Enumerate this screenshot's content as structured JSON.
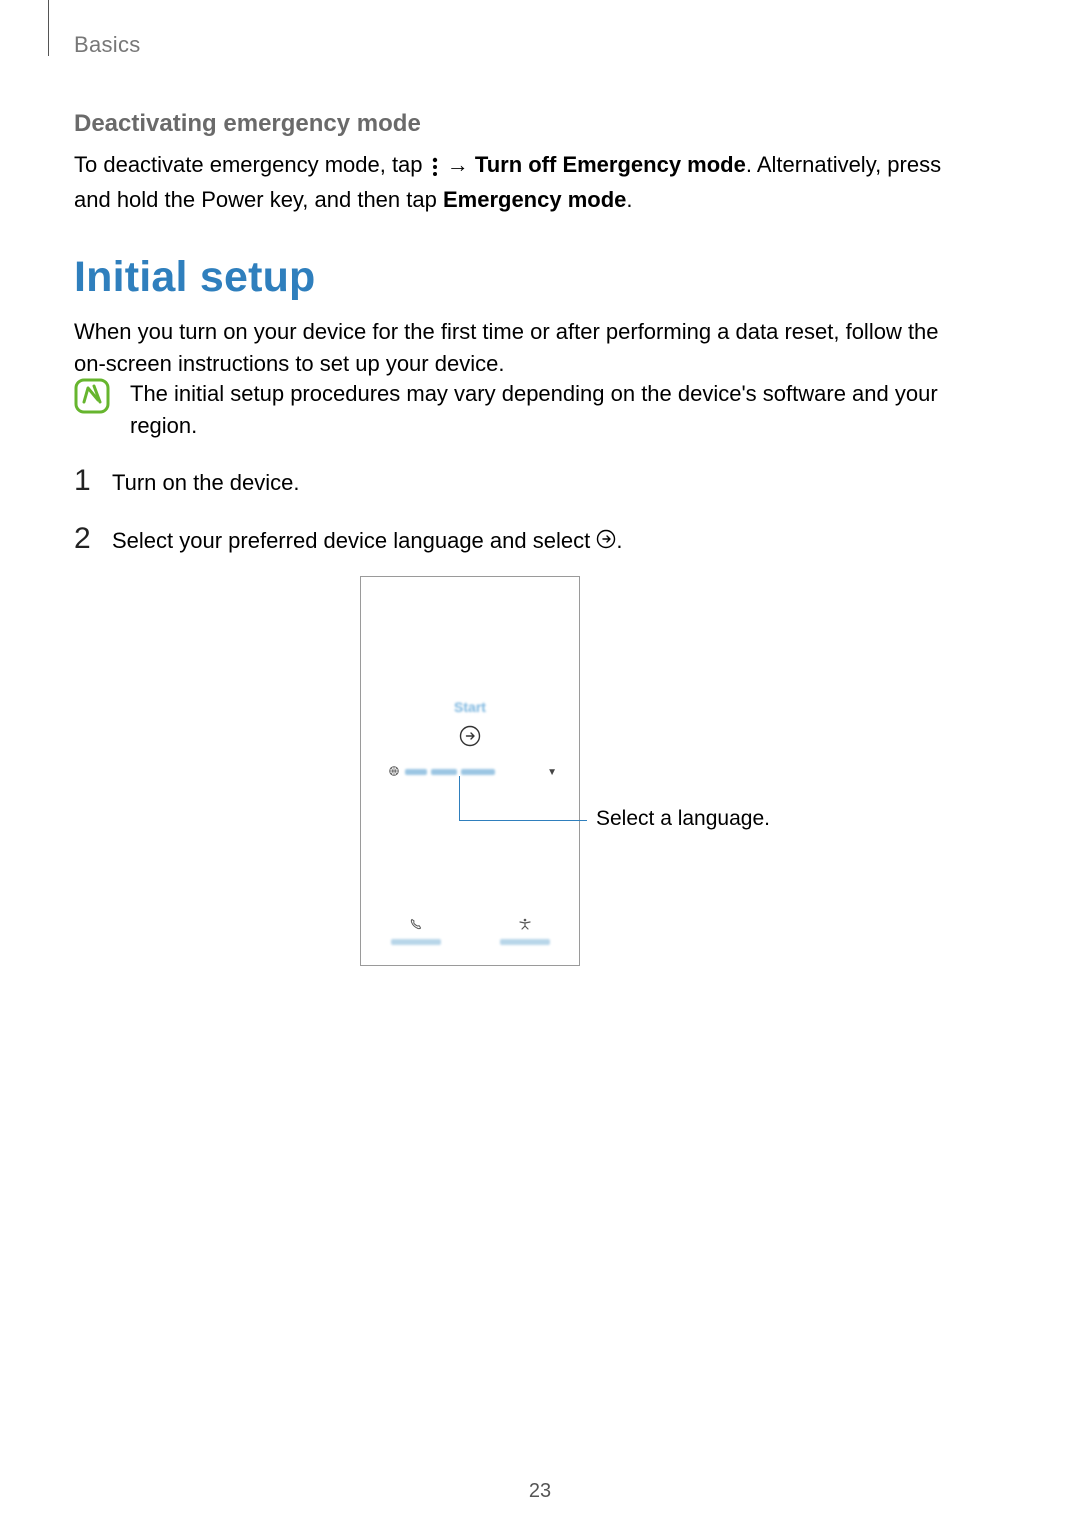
{
  "header": {
    "chapter": "Basics"
  },
  "section": {
    "subtitle": "Deactivating emergency mode",
    "para1_a": "To deactivate emergency mode, tap ",
    "para1_arrow": " → ",
    "para1_b": "Turn off Emergency mode",
    "para1_c": ". Alternatively, press and hold the Power key, and then tap ",
    "para1_d": "Emergency mode",
    "para1_e": "."
  },
  "h1": "Initial setup",
  "para2": "When you turn on your device for the first time or after performing a data reset, follow the on-screen instructions to set up your device.",
  "note": "The initial setup procedures may vary depending on the device's software and your region.",
  "steps": {
    "n1": "1",
    "s1": "Turn on the device.",
    "n2": "2",
    "s2a": "Select your preferred device language and select ",
    "s2b": "."
  },
  "phone": {
    "start_label": "Start"
  },
  "callout": "Select a language.",
  "page_number": "23"
}
